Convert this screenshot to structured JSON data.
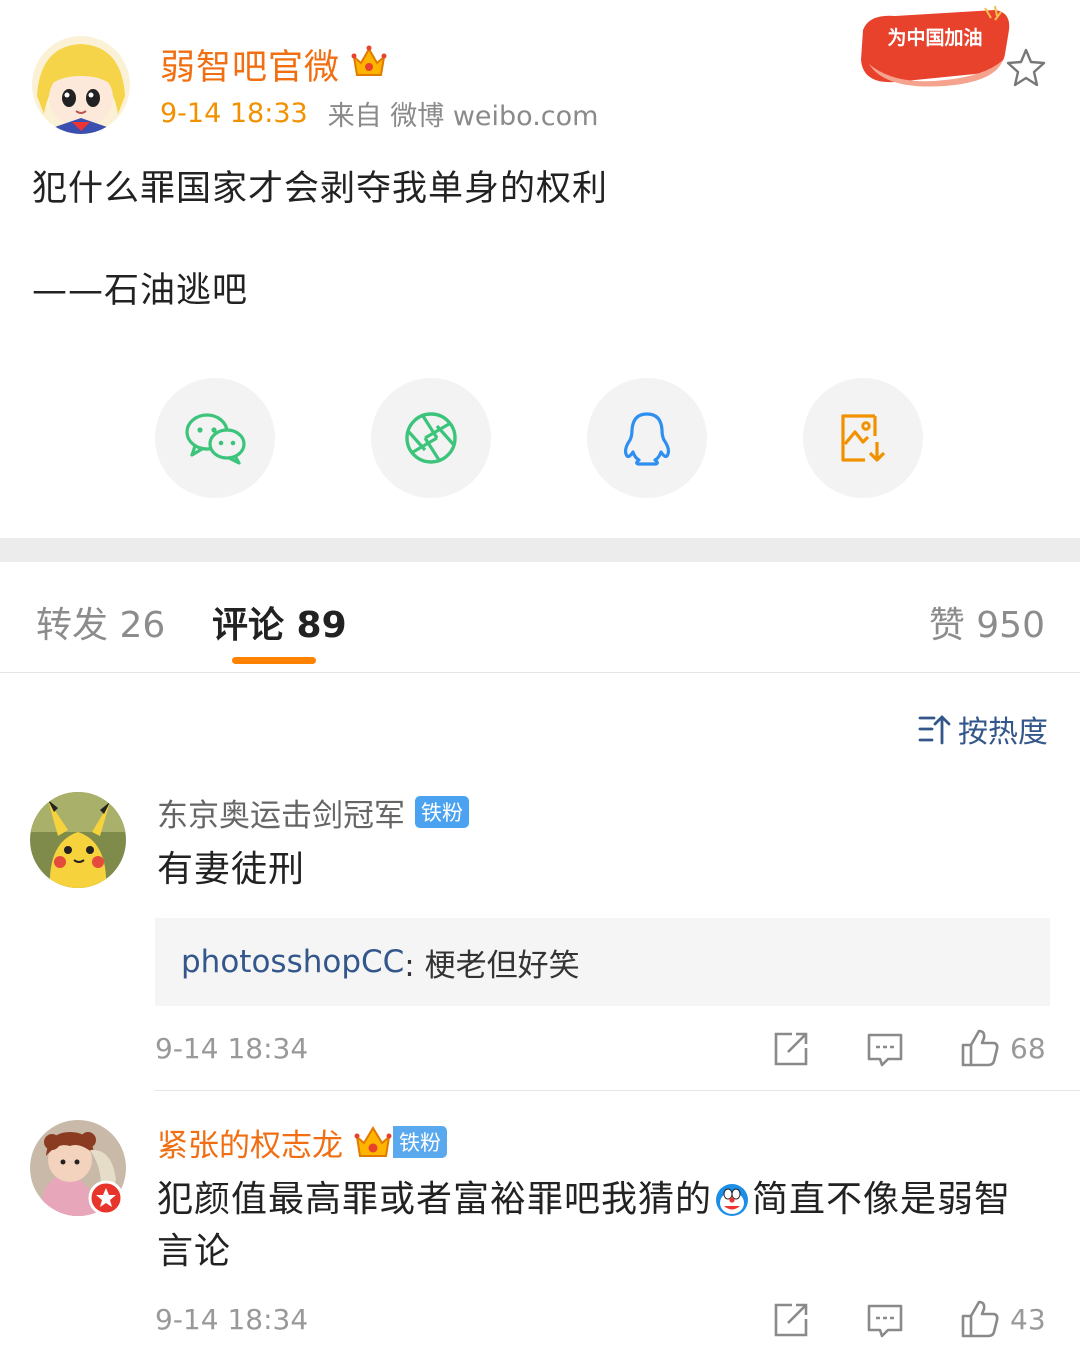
{
  "post": {
    "author": "弱智吧官微",
    "time": "9-14 18:33",
    "source": "来自 微博 weibo.com",
    "badge_text": "为中国加油",
    "line1": "犯什么罪国家才会剥夺我单身的权利",
    "line2": "——石油逃吧",
    "crown_icon": "crown-icon",
    "favorite_icon": "star-outline-icon"
  },
  "share": [
    {
      "name": "wechat",
      "icon": "wechat-icon",
      "color": "#3cc47a"
    },
    {
      "name": "moments",
      "icon": "moments-aperture-icon",
      "color": "#3cc47a"
    },
    {
      "name": "qq",
      "icon": "qq-penguin-icon",
      "color": "#2f8ff0"
    },
    {
      "name": "save-image",
      "icon": "save-image-icon",
      "color": "#f29100"
    }
  ],
  "tabs": {
    "repost": "转发 26",
    "comments": "评论 89",
    "like": "赞 950"
  },
  "sort": {
    "label": "按热度",
    "icon": "sort-icon"
  },
  "comments": [
    {
      "user": "东京奥运击剑冠军",
      "fan_badge": "铁粉",
      "text": "有妻徒刑",
      "reply_user": "photosshopCC",
      "reply_text": ": 梗老但好笑",
      "time": "9-14 18:34",
      "likes": "68"
    },
    {
      "user": "紧张的权志龙",
      "fan_badge": "铁粉",
      "text_line1": "犯颜值最高罪或者富裕罪吧我猜的",
      "text_line1b": "简直不像是弱智",
      "text_line2": "言论",
      "time": "9-14 18:34",
      "likes": "43"
    }
  ],
  "colors": {
    "accent": "#ff8200",
    "author": "#f16f12",
    "link": "#33568b"
  }
}
